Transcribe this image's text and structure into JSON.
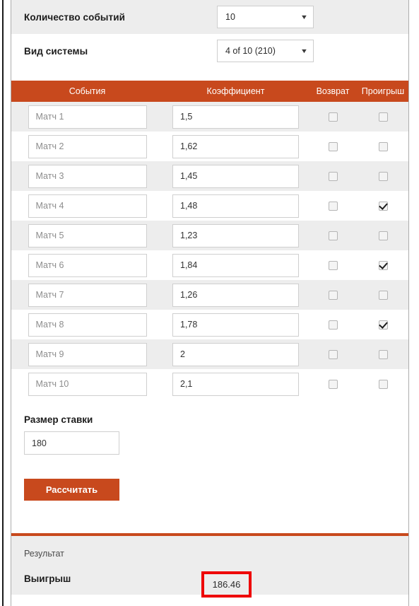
{
  "form": {
    "count_label": "Количество событий",
    "count_value": "10",
    "system_label": "Вид системы",
    "system_value": "4 of 10 (210)",
    "caret_glyph": "▼"
  },
  "table": {
    "headers": {
      "event": "События",
      "coefficient": "Коэффициент",
      "refund": "Возврат",
      "loss": "Проигрыш"
    },
    "rows": [
      {
        "event": "Матч 1",
        "coef": "1,5",
        "refund": false,
        "loss": false
      },
      {
        "event": "Матч 2",
        "coef": "1,62",
        "refund": false,
        "loss": false
      },
      {
        "event": "Матч 3",
        "coef": "1,45",
        "refund": false,
        "loss": false
      },
      {
        "event": "Матч 4",
        "coef": "1,48",
        "refund": false,
        "loss": true
      },
      {
        "event": "Матч 5",
        "coef": "1,23",
        "refund": false,
        "loss": false
      },
      {
        "event": "Матч 6",
        "coef": "1,84",
        "refund": false,
        "loss": true
      },
      {
        "event": "Матч 7",
        "coef": "1,26",
        "refund": false,
        "loss": false
      },
      {
        "event": "Матч 8",
        "coef": "1,78",
        "refund": false,
        "loss": true
      },
      {
        "event": "Матч 9",
        "coef": "2",
        "refund": false,
        "loss": false
      },
      {
        "event": "Матч 10",
        "coef": "2,1",
        "refund": false,
        "loss": false
      }
    ]
  },
  "stake": {
    "label": "Размер ставки",
    "value": "180",
    "calculate_label": "Рассчитать"
  },
  "result": {
    "title": "Результат",
    "win_label": "Выигрыш",
    "win_value": "186.46"
  },
  "colors": {
    "accent": "#c8491d",
    "highlight": "#ee0000",
    "stripe": "#ededed"
  }
}
